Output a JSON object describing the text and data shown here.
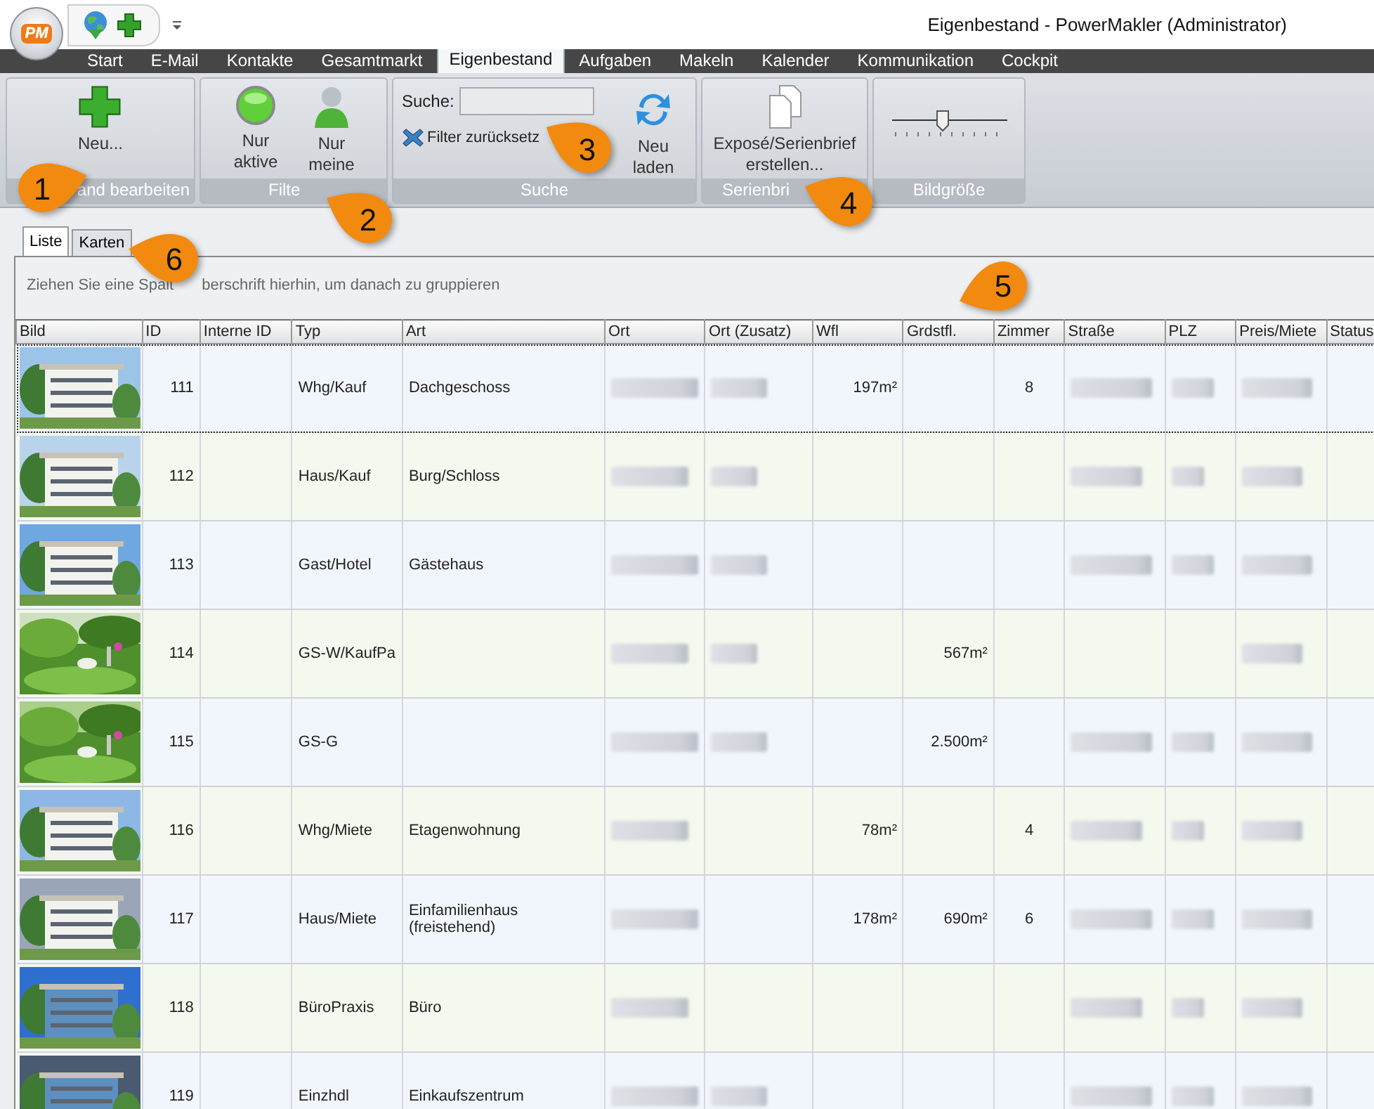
{
  "window": {
    "title": "Eigenbestand - PowerMakler (Administrator)",
    "logo": "PM"
  },
  "ribbon_tabs": [
    {
      "label": "Start",
      "selected": false
    },
    {
      "label": "E-Mail",
      "selected": false
    },
    {
      "label": "Kontakte",
      "selected": false
    },
    {
      "label": "Gesamtmarkt",
      "selected": false
    },
    {
      "label": "Eigenbestand",
      "selected": true
    },
    {
      "label": "Aufgaben",
      "selected": false
    },
    {
      "label": "Makeln",
      "selected": false
    },
    {
      "label": "Kalender",
      "selected": false
    },
    {
      "label": "Kommunikation",
      "selected": false
    },
    {
      "label": "Cockpit",
      "selected": false
    }
  ],
  "ribbon": {
    "new_button": "Neu...",
    "group_1": "and bearbeiten",
    "only_active": "Nur aktive",
    "only_mine": "Nur meine",
    "group_2": "Filte",
    "search_label": "Suche:",
    "reset_filter": "Filter zurücksetz",
    "reload": "Neu laden",
    "group_3": "Suche",
    "expose_button": "Exposé/Serienbrief erstellen...",
    "group_4": "Serienbri",
    "slider": {
      "level": 0.45
    },
    "group_5": "Bildgröße"
  },
  "view_tabs": [
    {
      "label": "Liste",
      "selected": true
    },
    {
      "label": "Karten",
      "selected": false
    }
  ],
  "group_hint": [
    "Ziehen Sie eine Spalt",
    "berschrift hierhin, um danach zu gruppieren"
  ],
  "columns": [
    "Bild",
    "ID",
    "Interne ID",
    "Typ",
    "Art",
    "Ort",
    "Ort (Zusatz)",
    "Wfl",
    "Grdstfl.",
    "Zimmer",
    "Straße",
    "PLZ",
    "Preis/Miete",
    "Status"
  ],
  "rows": [
    {
      "selected": true,
      "cells": [
        {
          "kind": "picture"
        },
        "111",
        {
          "kind": "empty"
        },
        "Whg/Kauf",
        "Dachgeschoss",
        {
          "kind": "blurred"
        },
        {
          "kind": "blurred"
        },
        "197m²",
        {
          "kind": "empty"
        },
        "8",
        {
          "kind": "blurred"
        },
        {
          "kind": "blurred"
        },
        {
          "kind": "blurred"
        },
        {
          "kind": "empty"
        }
      ]
    },
    {
      "selected": false,
      "cells": [
        {
          "kind": "picture"
        },
        "112",
        {
          "kind": "empty"
        },
        "Haus/Kauf",
        "Burg/Schloss",
        {
          "kind": "blurred"
        },
        {
          "kind": "blurred"
        },
        {
          "kind": "empty"
        },
        {
          "kind": "empty"
        },
        {
          "kind": "empty"
        },
        {
          "kind": "blurred"
        },
        {
          "kind": "blurred"
        },
        {
          "kind": "blurred"
        },
        {
          "kind": "empty"
        }
      ]
    },
    {
      "selected": false,
      "cells": [
        {
          "kind": "picture"
        },
        "113",
        {
          "kind": "empty"
        },
        "Gast/Hotel",
        "Gästehaus",
        {
          "kind": "blurred"
        },
        {
          "kind": "blurred"
        },
        {
          "kind": "empty"
        },
        {
          "kind": "empty"
        },
        {
          "kind": "empty"
        },
        {
          "kind": "blurred"
        },
        {
          "kind": "blurred"
        },
        {
          "kind": "blurred"
        },
        {
          "kind": "empty"
        }
      ]
    },
    {
      "selected": false,
      "cells": [
        {
          "kind": "picture"
        },
        "114",
        {
          "kind": "empty"
        },
        "GS-W/KaufPa",
        {
          "kind": "empty"
        },
        {
          "kind": "blurred"
        },
        {
          "kind": "blurred"
        },
        {
          "kind": "empty"
        },
        "567m²",
        {
          "kind": "empty"
        },
        {
          "kind": "empty"
        },
        {
          "kind": "empty"
        },
        {
          "kind": "blurred"
        },
        {
          "kind": "empty"
        }
      ]
    },
    {
      "selected": false,
      "cells": [
        {
          "kind": "picture"
        },
        "115",
        {
          "kind": "empty"
        },
        "GS-G",
        {
          "kind": "empty"
        },
        {
          "kind": "blurred"
        },
        {
          "kind": "blurred"
        },
        {
          "kind": "empty"
        },
        "2.500m²",
        {
          "kind": "empty"
        },
        {
          "kind": "blurred"
        },
        {
          "kind": "blurred"
        },
        {
          "kind": "blurred"
        },
        {
          "kind": "empty"
        }
      ]
    },
    {
      "selected": false,
      "cells": [
        {
          "kind": "picture"
        },
        "116",
        {
          "kind": "empty"
        },
        "Whg/Miete",
        "Etagenwohnung",
        {
          "kind": "blurred"
        },
        {
          "kind": "empty"
        },
        "78m²",
        {
          "kind": "empty"
        },
        "4",
        {
          "kind": "blurred"
        },
        {
          "kind": "blurred"
        },
        {
          "kind": "blurred"
        },
        {
          "kind": "empty"
        }
      ]
    },
    {
      "selected": false,
      "cells": [
        {
          "kind": "picture"
        },
        "117",
        {
          "kind": "empty"
        },
        "Haus/Miete",
        "Einfamilienhaus (freistehend)",
        {
          "kind": "blurred"
        },
        {
          "kind": "empty"
        },
        "178m²",
        "690m²",
        "6",
        {
          "kind": "blurred"
        },
        {
          "kind": "blurred"
        },
        {
          "kind": "blurred"
        },
        {
          "kind": "empty"
        }
      ]
    },
    {
      "selected": false,
      "cells": [
        {
          "kind": "picture"
        },
        "118",
        {
          "kind": "empty"
        },
        "BüroPraxis",
        "Büro",
        {
          "kind": "blurred"
        },
        {
          "kind": "empty"
        },
        {
          "kind": "empty"
        },
        {
          "kind": "empty"
        },
        {
          "kind": "empty"
        },
        {
          "kind": "blurred"
        },
        {
          "kind": "blurred"
        },
        {
          "kind": "blurred"
        },
        {
          "kind": "empty"
        }
      ]
    },
    {
      "selected": false,
      "cells": [
        {
          "kind": "picture"
        },
        "119",
        {
          "kind": "empty"
        },
        "Einzhdl",
        "Einkaufszentrum",
        {
          "kind": "blurred"
        },
        {
          "kind": "blurred"
        },
        {
          "kind": "empty"
        },
        {
          "kind": "empty"
        },
        {
          "kind": "empty"
        },
        {
          "kind": "blurred"
        },
        {
          "kind": "blurred"
        },
        {
          "kind": "blurred"
        },
        {
          "kind": "empty"
        }
      ]
    }
  ],
  "callouts": [
    "1",
    "2",
    "3",
    "4",
    "5",
    "6"
  ]
}
